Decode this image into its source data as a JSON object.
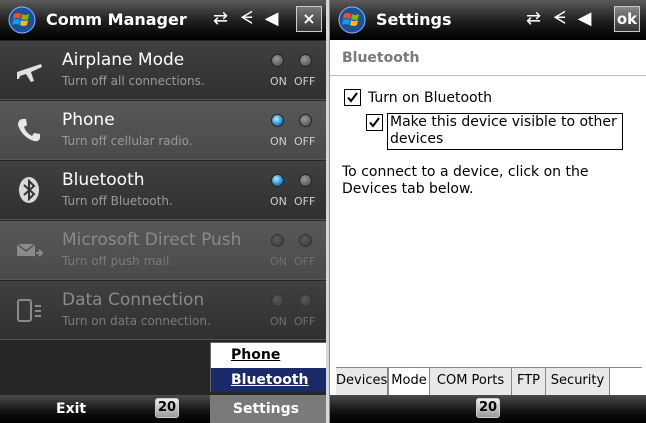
{
  "comm_manager": {
    "title": "Comm Manager",
    "title_icons": "⇄ ⛭ ◀",
    "close_label": "×",
    "rows": [
      {
        "title": "Airplane Mode",
        "subtitle": "Turn off all connections.",
        "icon": "airplane-icon",
        "state": "off",
        "enabled": true
      },
      {
        "title": "Phone",
        "subtitle": "Turn off cellular radio.",
        "icon": "phone-icon",
        "state": "on",
        "enabled": true
      },
      {
        "title": "Bluetooth",
        "subtitle": "Turn off Bluetooth.",
        "icon": "bluetooth-icon",
        "state": "on",
        "enabled": true
      },
      {
        "title": "Microsoft Direct Push",
        "subtitle": "Turn off push mail.",
        "icon": "push-mail-icon",
        "state": "none",
        "enabled": false
      },
      {
        "title": "Data Connection",
        "subtitle": "Turn on data connection.",
        "icon": "data-connection-icon",
        "state": "none",
        "enabled": false
      }
    ],
    "on_label": "ON",
    "off_label": "OFF",
    "menu": {
      "items": [
        "Phone",
        "Bluetooth"
      ],
      "selected": "Bluetooth"
    },
    "softkeys": {
      "left": "Exit",
      "center": "20",
      "right": "Settings"
    }
  },
  "settings": {
    "title": "Settings",
    "ok_label": "ok",
    "section": "Bluetooth",
    "turn_on_label": "Turn on Bluetooth",
    "visible_label_line1": "Make this device visible to other",
    "visible_label_line2": "devices",
    "turn_on_checked": true,
    "visible_checked": true,
    "info_text": "To connect to a device, click on the Devices tab below.",
    "tabs": [
      "Devices",
      "Mode",
      "COM Ports",
      "FTP",
      "Security"
    ],
    "active_tab": "Mode",
    "softkeys": {
      "center": "20"
    }
  },
  "colors": {
    "accent_blue": "#1e88d0",
    "menu_selected": "#1b2b6a"
  }
}
